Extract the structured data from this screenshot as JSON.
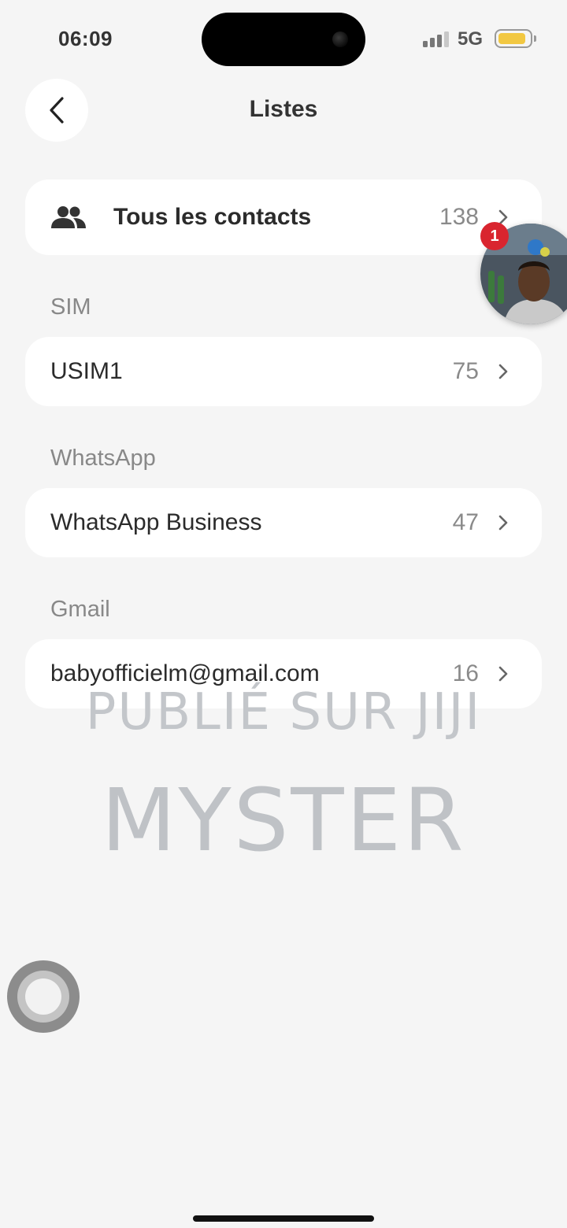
{
  "status_bar": {
    "time": "06:09",
    "network": "5G",
    "battery_color": "#f2c842"
  },
  "header": {
    "title": "Listes",
    "back_icon": "chevron-left-icon"
  },
  "all_contacts": {
    "icon": "people-icon",
    "label": "Tous les contacts",
    "count": "138"
  },
  "sections": [
    {
      "title": "SIM",
      "items": [
        {
          "label": "USIM1",
          "count": "75"
        }
      ]
    },
    {
      "title": "WhatsApp",
      "items": [
        {
          "label": "WhatsApp Business",
          "count": "47"
        }
      ]
    },
    {
      "title": "Gmail",
      "items": [
        {
          "label": "babyofficielm@gmail.com",
          "count": "16"
        }
      ]
    }
  ],
  "floating_chat": {
    "badge": "1",
    "badge_color": "#d9252f"
  },
  "watermark": {
    "line1": "PUBLIÉ SUR JIJI",
    "line2": "MYSTER"
  },
  "colors": {
    "background": "#f5f5f5",
    "card": "#ffffff",
    "muted_text": "#888888"
  }
}
